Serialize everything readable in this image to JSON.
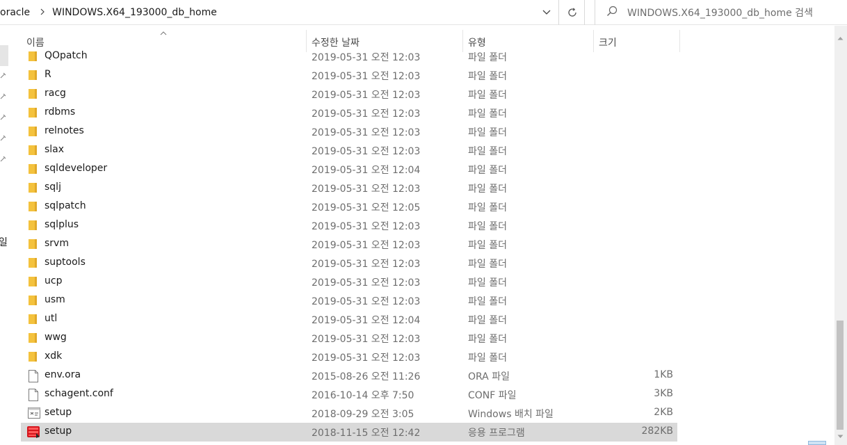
{
  "addressbar": {
    "crumbs": [
      "oracle",
      "WINDOWS.X64_193000_db_home"
    ]
  },
  "search": {
    "placeholder": "WINDOWS.X64_193000_db_home 검색"
  },
  "sidebar": {
    "fragment": "일"
  },
  "columns": {
    "name": "이름",
    "date": "수정한 날짜",
    "type": "유형",
    "size": "크기"
  },
  "files": [
    {
      "name": "QOpatch",
      "date": "2019-05-31 오전 12:03",
      "type": "파일 폴더",
      "size": "",
      "icon": "folder-icon"
    },
    {
      "name": "R",
      "date": "2019-05-31 오전 12:03",
      "type": "파일 폴더",
      "size": "",
      "icon": "folder-icon"
    },
    {
      "name": "racg",
      "date": "2019-05-31 오전 12:03",
      "type": "파일 폴더",
      "size": "",
      "icon": "folder-icon"
    },
    {
      "name": "rdbms",
      "date": "2019-05-31 오전 12:03",
      "type": "파일 폴더",
      "size": "",
      "icon": "folder-icon"
    },
    {
      "name": "relnotes",
      "date": "2019-05-31 오전 12:03",
      "type": "파일 폴더",
      "size": "",
      "icon": "folder-icon"
    },
    {
      "name": "slax",
      "date": "2019-05-31 오전 12:03",
      "type": "파일 폴더",
      "size": "",
      "icon": "folder-icon"
    },
    {
      "name": "sqldeveloper",
      "date": "2019-05-31 오전 12:04",
      "type": "파일 폴더",
      "size": "",
      "icon": "folder-icon"
    },
    {
      "name": "sqlj",
      "date": "2019-05-31 오전 12:03",
      "type": "파일 폴더",
      "size": "",
      "icon": "folder-icon"
    },
    {
      "name": "sqlpatch",
      "date": "2019-05-31 오전 12:05",
      "type": "파일 폴더",
      "size": "",
      "icon": "folder-icon"
    },
    {
      "name": "sqlplus",
      "date": "2019-05-31 오전 12:03",
      "type": "파일 폴더",
      "size": "",
      "icon": "folder-icon"
    },
    {
      "name": "srvm",
      "date": "2019-05-31 오전 12:03",
      "type": "파일 폴더",
      "size": "",
      "icon": "folder-icon"
    },
    {
      "name": "suptools",
      "date": "2019-05-31 오전 12:03",
      "type": "파일 폴더",
      "size": "",
      "icon": "folder-icon"
    },
    {
      "name": "ucp",
      "date": "2019-05-31 오전 12:03",
      "type": "파일 폴더",
      "size": "",
      "icon": "folder-icon"
    },
    {
      "name": "usm",
      "date": "2019-05-31 오전 12:03",
      "type": "파일 폴더",
      "size": "",
      "icon": "folder-icon"
    },
    {
      "name": "utl",
      "date": "2019-05-31 오전 12:04",
      "type": "파일 폴더",
      "size": "",
      "icon": "folder-icon"
    },
    {
      "name": "wwg",
      "date": "2019-05-31 오전 12:03",
      "type": "파일 폴더",
      "size": "",
      "icon": "folder-icon"
    },
    {
      "name": "xdk",
      "date": "2019-05-31 오전 12:03",
      "type": "파일 폴더",
      "size": "",
      "icon": "folder-icon"
    },
    {
      "name": "env.ora",
      "date": "2015-08-26 오전 11:26",
      "type": "ORA 파일",
      "size": "1KB",
      "icon": "file-icon"
    },
    {
      "name": "schagent.conf",
      "date": "2016-10-14 오후 7:50",
      "type": "CONF 파일",
      "size": "3KB",
      "icon": "file-icon"
    },
    {
      "name": "setup",
      "date": "2018-09-29 오전 3:05",
      "type": "Windows 배치 파일",
      "size": "2KB",
      "icon": "batch-file-icon"
    },
    {
      "name": "setup",
      "date": "2018-11-15 오전 12:42",
      "type": "응용 프로그램",
      "size": "282KB",
      "icon": "oracle-setup-icon"
    }
  ],
  "selected_index": 20,
  "colors": {
    "folder": "#f4c23d",
    "selection": "#d9d9d9",
    "scroll_thumb": "#c2c2c2"
  }
}
